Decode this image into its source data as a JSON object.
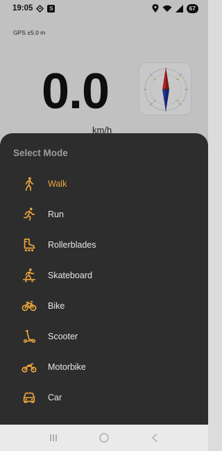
{
  "status_bar": {
    "time": "19:05",
    "battery": "67",
    "icons": [
      "navigation-icon",
      "sim-badge-icon",
      "location-icon",
      "wifi-icon",
      "signal-icon",
      "battery-icon"
    ]
  },
  "gps": {
    "accuracy_text": "GPS ±5.0 m"
  },
  "speed": {
    "value": "0.0",
    "unit": "km/h"
  },
  "compass": {
    "icon": "compass-icon"
  },
  "sheet": {
    "title": "Select Mode",
    "items": [
      {
        "label": "Walk",
        "icon": "walk-icon",
        "selected": true
      },
      {
        "label": "Run",
        "icon": "run-icon",
        "selected": false
      },
      {
        "label": "Rollerblades",
        "icon": "rollerblade-icon",
        "selected": false
      },
      {
        "label": "Skateboard",
        "icon": "skateboard-icon",
        "selected": false
      },
      {
        "label": "Bike",
        "icon": "bike-icon",
        "selected": false
      },
      {
        "label": "Scooter",
        "icon": "scooter-icon",
        "selected": false
      },
      {
        "label": "Motorbike",
        "icon": "motorbike-icon",
        "selected": false
      },
      {
        "label": "Car",
        "icon": "car-icon",
        "selected": false
      }
    ]
  },
  "nav_bar": {
    "buttons": [
      "recents-icon",
      "home-icon",
      "back-icon"
    ]
  },
  "colors": {
    "accent": "#efa73b",
    "sheet_bg": "#2d2d2d",
    "title_gray": "#9c9c9c"
  }
}
